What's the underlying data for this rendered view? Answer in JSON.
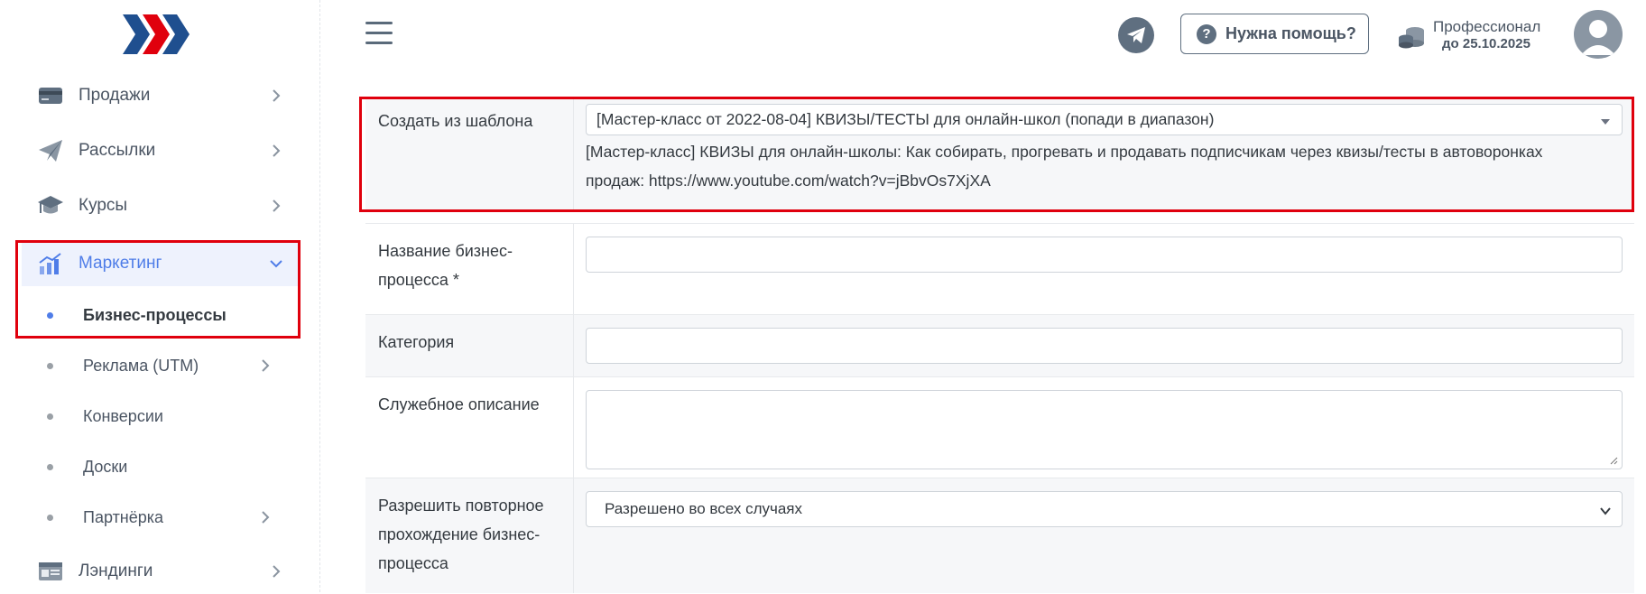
{
  "sidebar": {
    "items": [
      {
        "label": "Продажи",
        "icon": "credit-card-icon"
      },
      {
        "label": "Рассылки",
        "icon": "paper-plane-icon"
      },
      {
        "label": "Курсы",
        "icon": "graduation-cap-icon"
      },
      {
        "label": "Маркетинг",
        "icon": "chart-icon",
        "active": true
      },
      {
        "label": "Лэндинги",
        "icon": "landing-icon"
      }
    ],
    "marketing_sub": [
      {
        "label": "Бизнес-процессы",
        "current": true
      },
      {
        "label": "Реклама (UTM)"
      },
      {
        "label": "Конверсии"
      },
      {
        "label": "Доски"
      },
      {
        "label": "Партнёрка"
      }
    ]
  },
  "header": {
    "help_label": "Нужна помощь?",
    "help_icon": "?",
    "plan_name": "Профессионал",
    "plan_until": "до 25.10.2025"
  },
  "form": {
    "template": {
      "label": "Создать из шаблона",
      "selected": "[Мастер-класс от 2022-08-04] КВИЗЫ/ТЕСТЫ для онлайн-школ (попади в диапазон)",
      "description": "[Мастер-класс] КВИЗЫ для онлайн-школы: Как собирать, прогревать и продавать подписчикам через квизы/тесты в автоворонках продаж: https://www.youtube.com/watch?v=jBbvOs7XjXA"
    },
    "name": {
      "label": "Название бизнес-процесса *",
      "value": ""
    },
    "category": {
      "label": "Категория",
      "value": ""
    },
    "description": {
      "label": "Служебное описание",
      "value": ""
    },
    "repeat": {
      "label": "Разрешить повторное прохождение бизнес-процесса",
      "selected": "Разрешено во всех случаях"
    }
  },
  "colors": {
    "accent": "#4f7de8",
    "highlight": "#e0000d",
    "logo_blue": "#1f4f8f",
    "logo_red": "#e0000d"
  }
}
